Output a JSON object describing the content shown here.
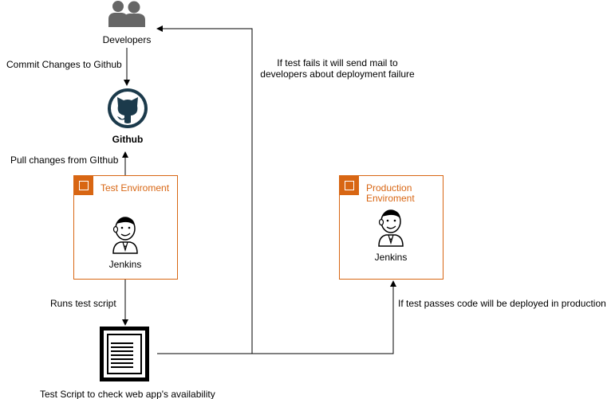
{
  "nodes": {
    "developers": {
      "label": "Developers",
      "icon": "users-icon"
    },
    "github": {
      "label": "Github",
      "icon": "github-icon"
    },
    "test_env": {
      "title": "Test Enviroment",
      "icon": "ec2-instance-icon"
    },
    "test_jenkins": {
      "label": "Jenkins",
      "icon": "jenkins-icon"
    },
    "prod_env": {
      "title_line1": "Production",
      "title_line2": "Enviroment",
      "icon": "ec2-instance-icon"
    },
    "prod_jenkins": {
      "label": "Jenkins",
      "icon": "jenkins-icon"
    },
    "test_script": {
      "label": "Test Script to check web app's availability",
      "icon": "document-icon"
    }
  },
  "edges": {
    "commit": "Commit Changes to Github",
    "pull": "Pull changes from GIthub",
    "runs": "Runs test script",
    "fail_line1": "If  test fails it will send mail to",
    "fail_line2": "developers about deployment failure",
    "pass": "If test passes code will be deployed in production"
  },
  "colors": {
    "aws_orange": "#d86613",
    "line": "#000000",
    "icon_gray": "#666666",
    "github_dark": "#1b3a4b"
  }
}
